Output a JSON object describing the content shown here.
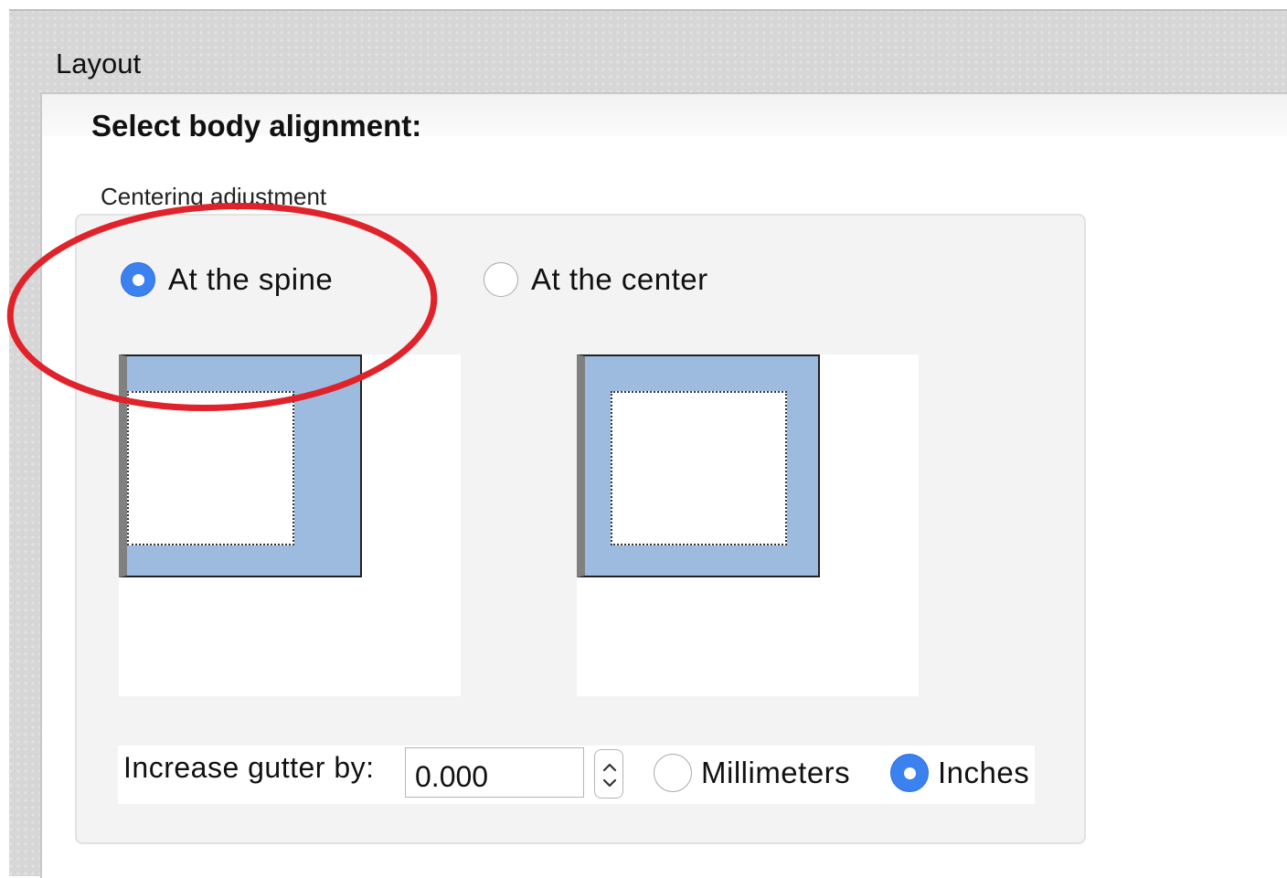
{
  "window": {
    "title": "Layout"
  },
  "main": {
    "heading": "Select body alignment:",
    "group_label": "Centering adjustment",
    "alignment_options": [
      {
        "label": "At the spine",
        "selected": true
      },
      {
        "label": "At the center",
        "selected": false
      }
    ],
    "gutter": {
      "label": "Increase gutter by:",
      "value": "0.000"
    },
    "units": [
      {
        "label": "Millimeters",
        "selected": false
      },
      {
        "label": "Inches",
        "selected": true
      }
    ]
  },
  "colors": {
    "radio_selected": "#3b82f0",
    "page_fill": "#9dbbdf",
    "spine": "#808080",
    "annotation": "#e0232b"
  },
  "icons": [
    "up-down-stepper-icon"
  ]
}
